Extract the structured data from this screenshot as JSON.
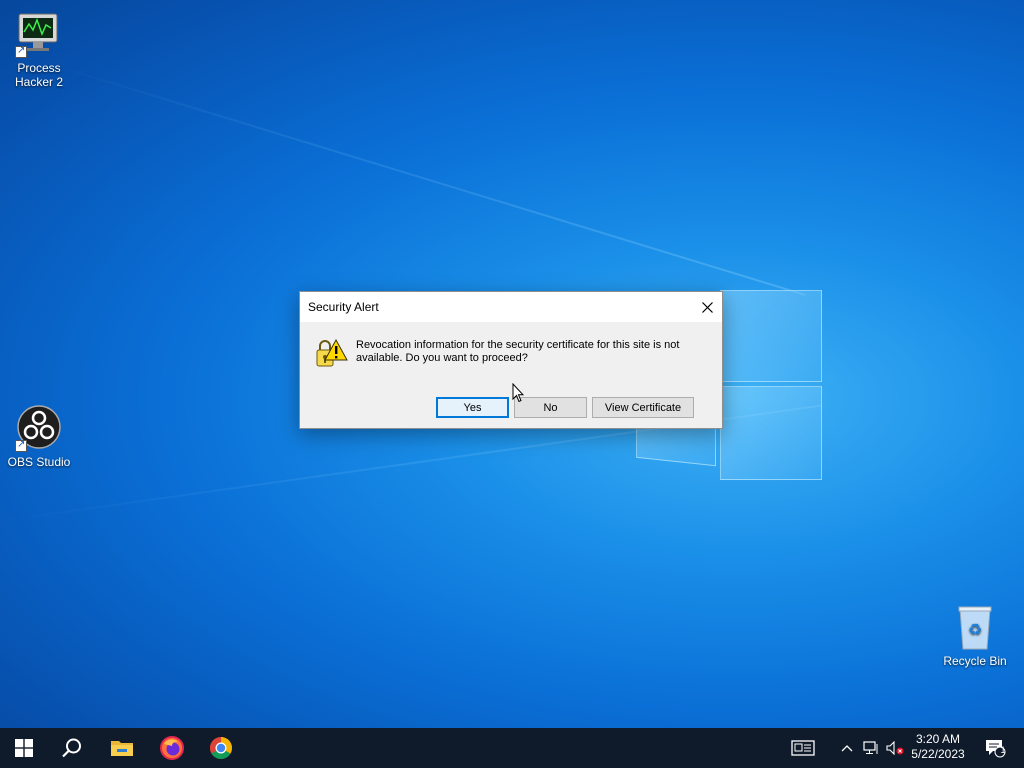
{
  "desktop": {
    "icons": [
      {
        "label": "Process Hacker 2",
        "icon": "process-hacker-icon"
      },
      {
        "label": "OBS Studio",
        "icon": "obs-studio-icon"
      },
      {
        "label": "Recycle Bin",
        "icon": "recycle-bin-icon"
      }
    ]
  },
  "dialog": {
    "title": "Security Alert",
    "message": "Revocation information for the security certificate for this site is not available. Do you want to proceed?",
    "icon": "security-warning-icon",
    "buttons": {
      "yes": "Yes",
      "no": "No",
      "view_certificate": "View Certificate"
    }
  },
  "taskbar": {
    "pinned": [
      {
        "name": "start",
        "icon": "windows-start-icon"
      },
      {
        "name": "search",
        "icon": "search-icon"
      },
      {
        "name": "file-explorer",
        "icon": "folder-icon"
      },
      {
        "name": "firefox",
        "icon": "firefox-icon"
      },
      {
        "name": "chrome",
        "icon": "chrome-icon"
      }
    ],
    "tray": {
      "icons": [
        "news-icon",
        "chevron-up-icon",
        "network-icon",
        "volume-muted-icon"
      ],
      "time": "3:20 AM",
      "date": "5/22/2023",
      "notification_count": "1"
    }
  },
  "colors": {
    "accent": "#0078d7",
    "taskbar": "#0f1a2b",
    "dialog_bg": "#f0f0f0"
  }
}
